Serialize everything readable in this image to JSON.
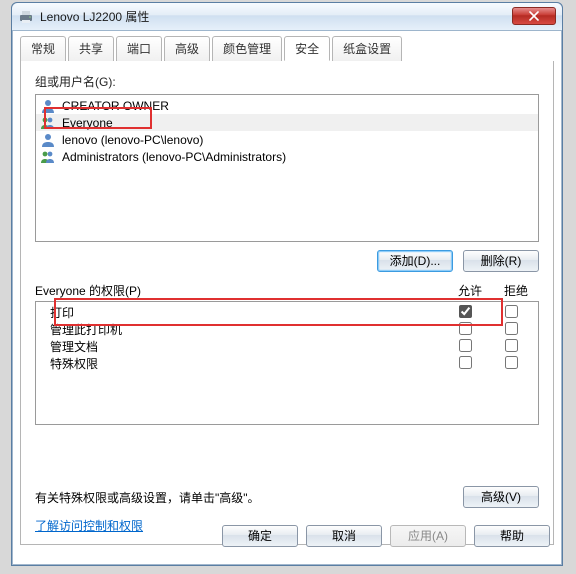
{
  "window": {
    "title": "Lenovo LJ2200 属性"
  },
  "tabs": [
    "常规",
    "共享",
    "端口",
    "高级",
    "颜色管理",
    "安全",
    "纸盒设置"
  ],
  "activeTab": 5,
  "groupsLabel": "组或用户名(G):",
  "groups": [
    {
      "name": "CREATOR OWNER",
      "iconType": "user"
    },
    {
      "name": "Everyone",
      "iconType": "group"
    },
    {
      "name": "lenovo  (lenovo-PC\\lenovo)",
      "iconType": "user"
    },
    {
      "name": "Administrators  (lenovo-PC\\Administrators)",
      "iconType": "group"
    }
  ],
  "selectedGroupIndex": 1,
  "buttons": {
    "add": "添加(D)...",
    "remove": "删除(R)",
    "advanced": "高级(V)",
    "ok": "确定",
    "cancel": "取消",
    "apply": "应用(A)",
    "help": "帮助"
  },
  "perm": {
    "label": "Everyone 的权限(P)",
    "allow": "允许",
    "deny": "拒绝",
    "rows": [
      {
        "name": "打印",
        "allow": true,
        "deny": false
      },
      {
        "name": "管理此打印机",
        "allow": false,
        "deny": false
      },
      {
        "name": "管理文档",
        "allow": false,
        "deny": false
      },
      {
        "name": "特殊权限",
        "allow": false,
        "deny": false
      }
    ]
  },
  "advText": "有关特殊权限或高级设置，请单击\"高级\"。",
  "link": "了解访问控制和权限"
}
